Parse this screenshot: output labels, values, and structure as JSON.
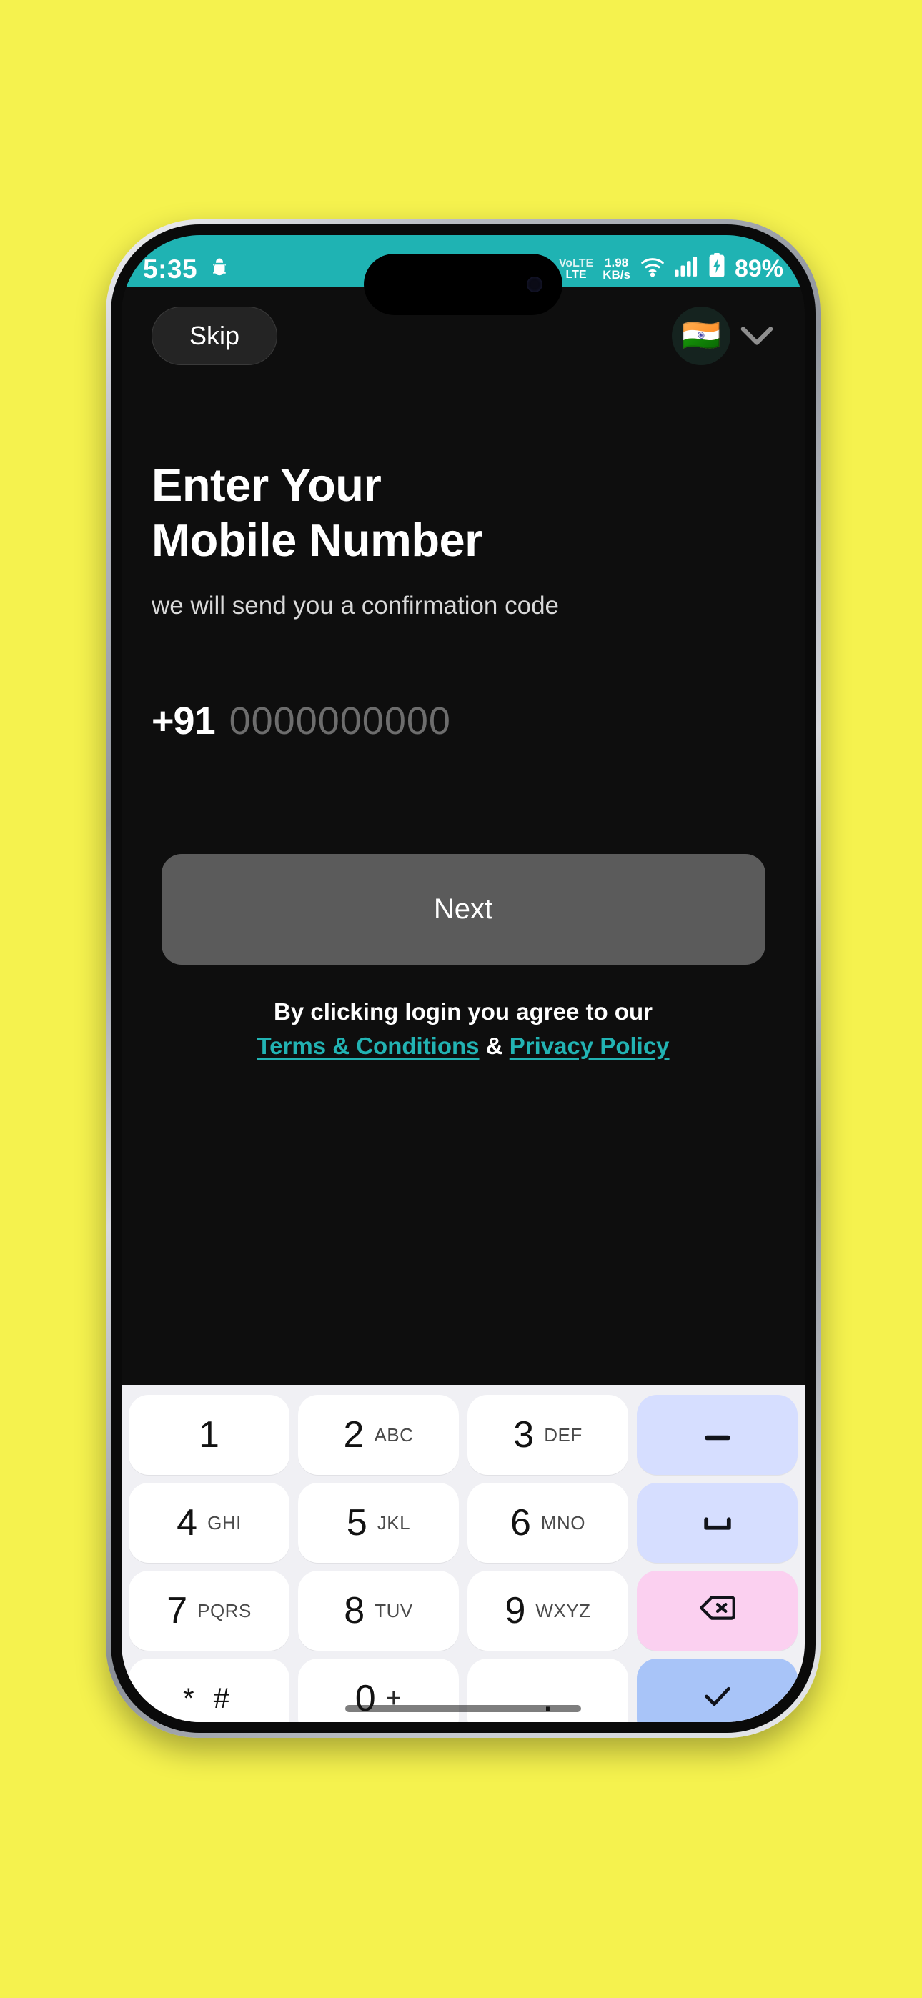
{
  "background_color": "#f5f24e",
  "status_bar": {
    "time": "5:35",
    "left_icons": [
      "android-debug-icon"
    ],
    "right_icons": [
      "alarm-icon",
      "mute-icon",
      "volte-icon",
      "network-speed-icon",
      "wifi-icon",
      "signal-icon",
      "battery-charging-icon"
    ],
    "volte_label_top": "VoLTE",
    "volte_label_bottom": "LTE",
    "net_speed_value": "1.98",
    "net_speed_unit": "KB/s",
    "battery_percent": "89%",
    "bar_color": "#1fb3b3"
  },
  "header": {
    "skip_label": "Skip",
    "country_flag": "🇮🇳",
    "chevron_icon": "chevron-down-icon"
  },
  "main": {
    "headline_line1": "Enter Your",
    "headline_line2": "Mobile Number",
    "subtitle": "we will send you a confirmation code",
    "country_code": "+91",
    "phone_placeholder": "0000000000",
    "phone_value": "",
    "next_label": "Next",
    "next_button_color": "#5b5b5b",
    "terms_prefix": "By clicking login you agree to our",
    "terms_link": "Terms & Conditions",
    "terms_amp": "&",
    "privacy_link": "Privacy Policy",
    "link_color": "#22b3b3"
  },
  "keyboard": {
    "rows": [
      [
        {
          "digit": "1",
          "letters": "",
          "type": "digit"
        },
        {
          "digit": "2",
          "letters": "ABC",
          "type": "digit"
        },
        {
          "digit": "3",
          "letters": "DEF",
          "type": "digit"
        },
        {
          "digit": "–",
          "letters": "",
          "type": "fn-blue-light",
          "icon": "dash-icon"
        }
      ],
      [
        {
          "digit": "4",
          "letters": "GHI",
          "type": "digit"
        },
        {
          "digit": "5",
          "letters": "JKL",
          "type": "digit"
        },
        {
          "digit": "6",
          "letters": "MNO",
          "type": "digit"
        },
        {
          "digit": "␣",
          "letters": "",
          "type": "fn-blue-light",
          "icon": "space-icon"
        }
      ],
      [
        {
          "digit": "7",
          "letters": "PQRS",
          "type": "digit"
        },
        {
          "digit": "8",
          "letters": "TUV",
          "type": "digit"
        },
        {
          "digit": "9",
          "letters": "WXYZ",
          "type": "digit"
        },
        {
          "digit": "⌫",
          "letters": "",
          "type": "fn-pink",
          "icon": "backspace-icon"
        }
      ],
      [
        {
          "digit": "* #",
          "letters": "",
          "type": "symbol"
        },
        {
          "digit": "0",
          "letters": "+",
          "type": "digit"
        },
        {
          "digit": ".",
          "letters": "",
          "type": "dot"
        },
        {
          "digit": "✓",
          "letters": "",
          "type": "fn-blue",
          "icon": "check-icon"
        }
      ]
    ],
    "background_color": "#f0f0f4"
  }
}
